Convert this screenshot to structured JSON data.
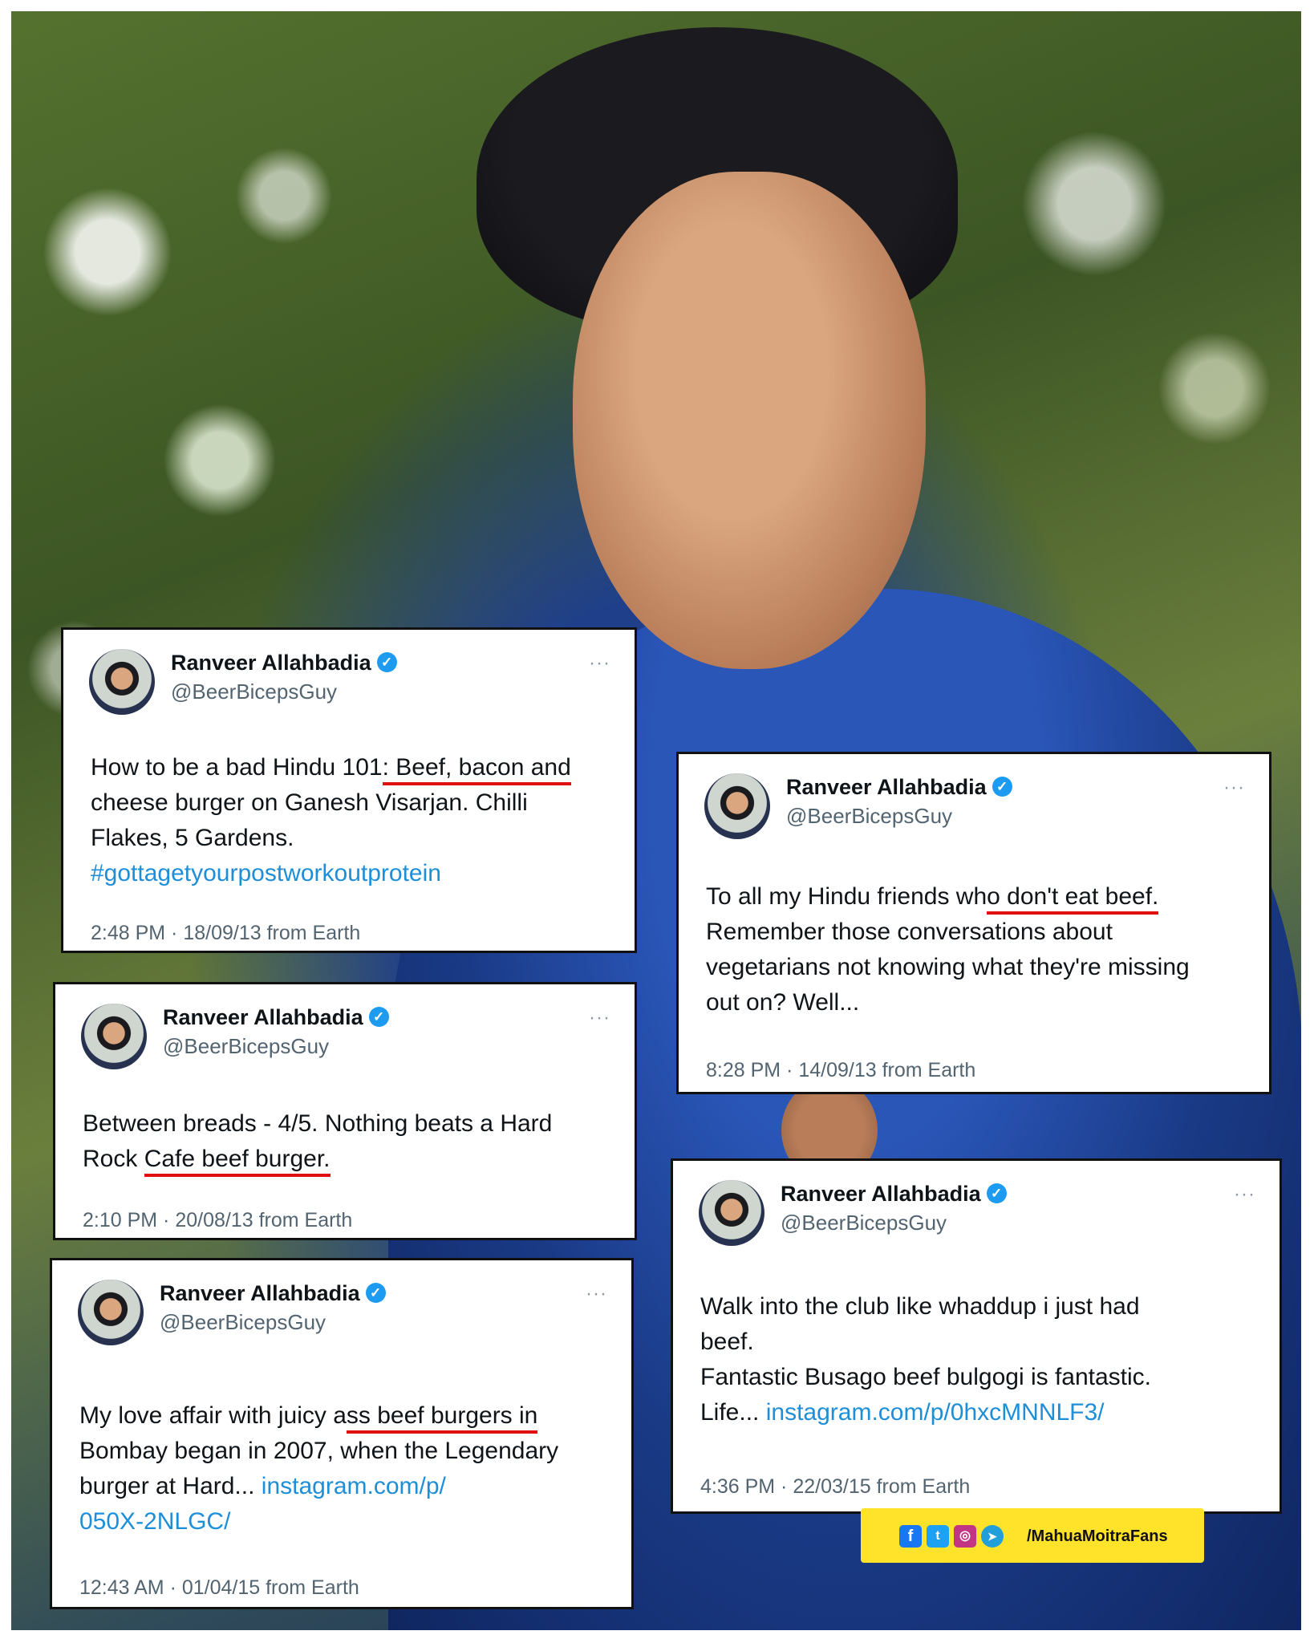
{
  "tweets": [
    {
      "name": "Ranveer Allahbadia",
      "handle": "@BeerBicepsGuy",
      "text_lines": [
        [
          "How to be a bad Hindu 101",
          ": Beef, bacon and"
        ],
        [
          "cheese burger on Ganesh Visarjan. Chilli"
        ],
        [
          "Flakes, 5 Gardens."
        ],
        [
          "#gottagetyourpostworkoutprotein"
        ]
      ],
      "meta": "2:48 PM · 18/09/13 from Earth"
    },
    {
      "name": "Ranveer Allahbadia",
      "handle": "@BeerBicepsGuy",
      "text_lines": [
        [
          "To all my Hindu friends wh",
          "o don't eat beef."
        ],
        [
          "Remember those conversations about"
        ],
        [
          "vegetarians not knowing what they're missing"
        ],
        [
          "out on? Well..."
        ]
      ],
      "meta": "8:28 PM · 14/09/13 from Earth"
    },
    {
      "name": "Ranveer Allahbadia",
      "handle": "@BeerBicepsGuy",
      "text_lines": [
        [
          "Between breads - 4/5. Nothing beats a Hard"
        ],
        [
          "Rock ",
          "Cafe beef burger."
        ]
      ],
      "meta": "2:10 PM · 20/08/13 from Earth"
    },
    {
      "name": "Ranveer Allahbadia",
      "handle": "@BeerBicepsGuy",
      "text_lines": [
        [
          "Walk into the club like whaddup i just had"
        ],
        [
          "beef."
        ],
        [
          "Fantastic Busago beef bulgogi is fantastic."
        ],
        [
          "Life... ",
          "instagram.com/p/0hxcMNNLF3/"
        ]
      ],
      "meta": "4:36 PM · 22/03/15 from Earth"
    },
    {
      "name": "Ranveer Allahbadia",
      "handle": "@BeerBicepsGuy",
      "text_lines": [
        [
          "My love affair with juicy a",
          "ss beef burgers in"
        ],
        [
          "Bombay began in 2007, when the Legendary"
        ],
        [
          "burger at Hard... ",
          "instagram.com/p/"
        ],
        [
          "050X-2NLGC/"
        ]
      ],
      "meta": "12:43 AM · 01/04/15 from Earth"
    }
  ],
  "more_icon": "···",
  "verified_icon": "✓",
  "badge": {
    "label": "/MahuaMoitraFans",
    "icons": [
      "facebook-icon",
      "twitter-icon",
      "instagram-icon",
      "telegram-icon"
    ],
    "colors": {
      "background": "#ffe32a",
      "facebook": "#1877f2",
      "twitter": "#1da1f2",
      "instagram": "#c13584",
      "telegram": "#229ed9"
    }
  },
  "colors": {
    "link": "#1d8ed8",
    "underline": "#e01010",
    "verified": "#1d9bf0"
  }
}
